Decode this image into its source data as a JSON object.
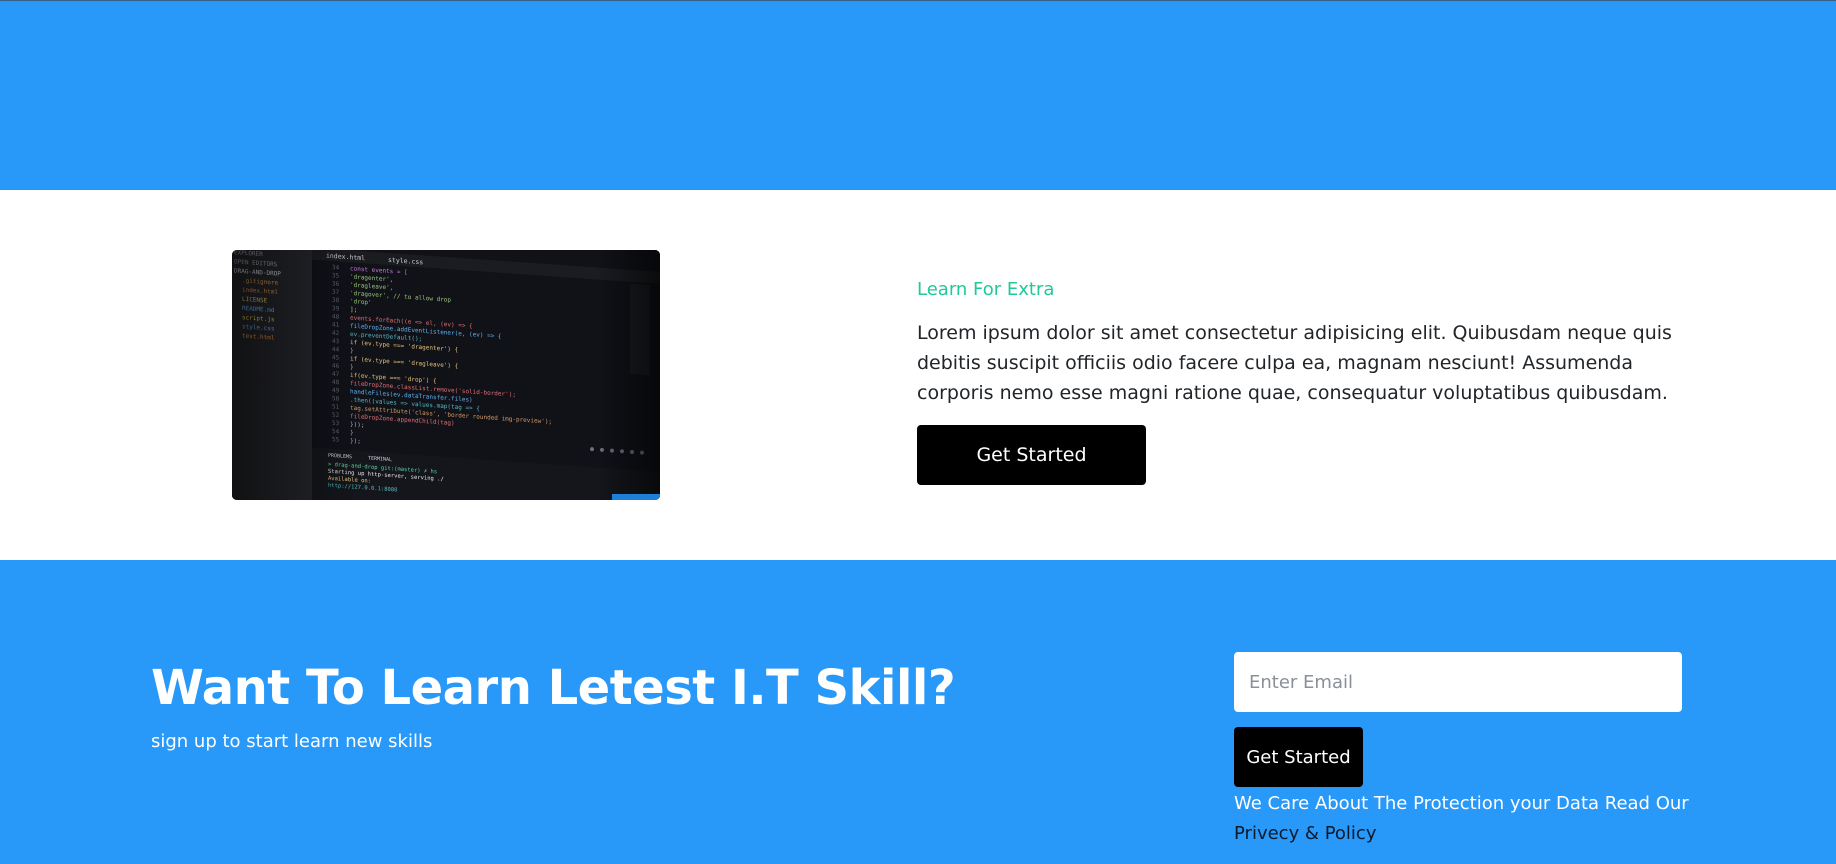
{
  "feature": {
    "eyebrow": "Learn For Extra",
    "body": "Lorem ipsum dolor sit amet consectetur adipisicing elit. Quibusdam neque quis debitis suscipit officiis odio facere culpa ea, magnam nesciunt! Assumenda corporis nemo esse magni ratione quae, consequatur voluptatibus quibusdam.",
    "button_label": "Get Started",
    "image": {
      "tabs": [
        "index.html",
        "style.css"
      ],
      "explorer_items": [
        "EXPLORER",
        "OPEN EDITORS",
        "DRAG-AND-DROP",
        ".gitignore",
        "index.html",
        "LICENSE",
        "README.md",
        "script.js",
        "style.css",
        "test.html"
      ],
      "line_numbers": [
        "34",
        "35",
        "36",
        "37",
        "38",
        "39",
        "40",
        "41",
        "42",
        "43",
        "44",
        "45",
        "46",
        "47",
        "48",
        "49",
        "50",
        "51",
        "52",
        "53",
        "54",
        "55"
      ],
      "code_lines": [
        "const events = [",
        "  'dragenter',",
        "  'dragleave',",
        "  'dragover', // to allow drop",
        "  'drop'",
        "];",
        "events.forEach((e => el, (ev) => {",
        "  fileDropZone.addEventListener(e, (ev) => {",
        "    ev.preventDefault();",
        "    if (ev.type === 'dragenter') {",
        "    }",
        "    if (ev.type === 'dragleave') {",
        "    }",
        "    if(ev.type === 'drop') {",
        "      fileDropZone.classList.remove('solid-border');",
        "      handleFiles(ev.dataTransfer.files)",
        "        .then((values => values.map(tag => {",
        "          tag.setAttribute('class', 'border rounded img-preview');",
        "          fileDropZone.appendChild(tag)",
        "        }));",
        "    }",
        "  });"
      ],
      "terminal_tabs": [
        "PROBLEMS",
        "TERMINAL"
      ],
      "terminal_lines": [
        "> drag-and-drop git:(master) ✗ hs",
        "Starting up http-server, serving ./",
        "Available on:",
        "  http://127.0.0.1:8080"
      ]
    }
  },
  "cta": {
    "title": "Want To Learn Letest I.T Skill?",
    "subtitle": "sign up to start learn new skills",
    "email_placeholder": "Enter Email",
    "button_label": "Get Started",
    "privacy_text": "We Care About The Protection your Data Read Our",
    "privacy_link": "Privecy & Policy"
  },
  "colors": {
    "brand_blue": "#2898f9",
    "accent_green": "#20c997",
    "button_black": "#000000",
    "white": "#ffffff"
  }
}
